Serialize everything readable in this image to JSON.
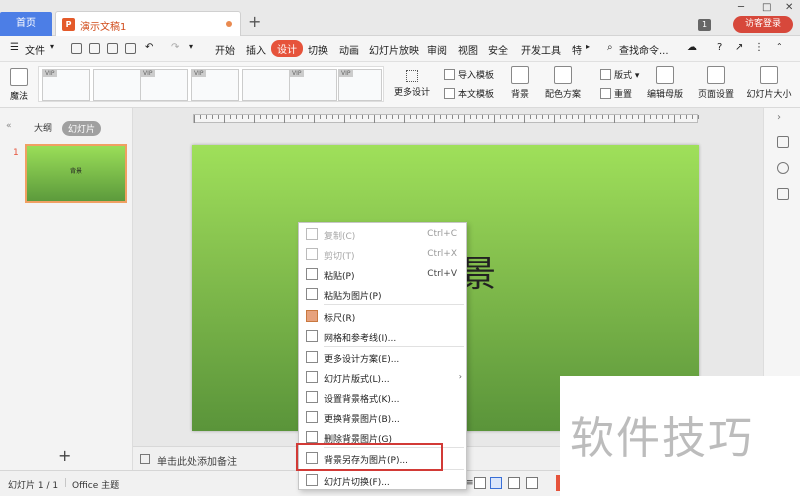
{
  "titlebar": {
    "home_tab": "首页",
    "doc_tab": "演示文稿1",
    "ppt_icon_letter": "P",
    "new_tab": "+",
    "badge": "1",
    "visitor_login": "访客登录"
  },
  "menubar": {
    "file": "文件",
    "items": [
      "开始",
      "插入",
      "设计",
      "切换",
      "动画",
      "幻灯片放映",
      "审阅",
      "视图",
      "安全",
      "开发工具",
      "特"
    ],
    "active": "设计",
    "search": "查找命令..."
  },
  "ribbon": {
    "magic": "魔法",
    "more_design": "更多设计",
    "import_template": "导入模板",
    "text_template": "本文模板",
    "background": "背景",
    "color_scheme": "配色方案",
    "layout": "版式",
    "reset": "重置",
    "edit_master": "编辑母版",
    "page_setup": "页面设置",
    "slide_size": "幻灯片大小",
    "vip": "VIP"
  },
  "leftpanel": {
    "outline_tab": "大纲",
    "slides_tab": "幻灯片",
    "slide_num": "1",
    "thumb_text": "背景",
    "add": "+"
  },
  "slide": {
    "title_fragment": "景"
  },
  "notes": {
    "placeholder": "单击此处添加备注"
  },
  "status": {
    "slide_info": "幻灯片 1 / 1",
    "theme": "Office 主题"
  },
  "context_menu": {
    "items": [
      {
        "label": "复制(C)",
        "shortcut": "Ctrl+C",
        "disabled": true
      },
      {
        "label": "剪切(T)",
        "shortcut": "Ctrl+X",
        "disabled": true
      },
      {
        "label": "粘贴(P)",
        "shortcut": "Ctrl+V",
        "disabled": false
      },
      {
        "label": "粘贴为图片(P)",
        "shortcut": "",
        "disabled": false
      },
      {
        "label": "标尺(R)",
        "shortcut": "",
        "disabled": false,
        "checked": true
      },
      {
        "label": "网格和参考线(I)...",
        "shortcut": "",
        "disabled": false
      },
      {
        "label": "更多设计方案(E)...",
        "shortcut": "",
        "disabled": false
      },
      {
        "label": "幻灯片版式(L)...",
        "shortcut": "",
        "disabled": false,
        "submenu": true
      },
      {
        "label": "设置背景格式(K)...",
        "shortcut": "",
        "disabled": false
      },
      {
        "label": "更换背景图片(B)...",
        "shortcut": "",
        "disabled": false
      },
      {
        "label": "删除背景图片(G)",
        "shortcut": "",
        "disabled": false
      },
      {
        "label": "背景另存为图片(P)...",
        "shortcut": "",
        "disabled": false,
        "highlighted": true
      },
      {
        "label": "幻灯片切换(F)...",
        "shortcut": "",
        "disabled": false
      }
    ],
    "submenu_arrow": "›"
  },
  "watermark": "软件技巧",
  "colors": {
    "accent": "#e6533b",
    "home_tab": "#4c7ee6",
    "highlight_box": "#d23a36"
  }
}
